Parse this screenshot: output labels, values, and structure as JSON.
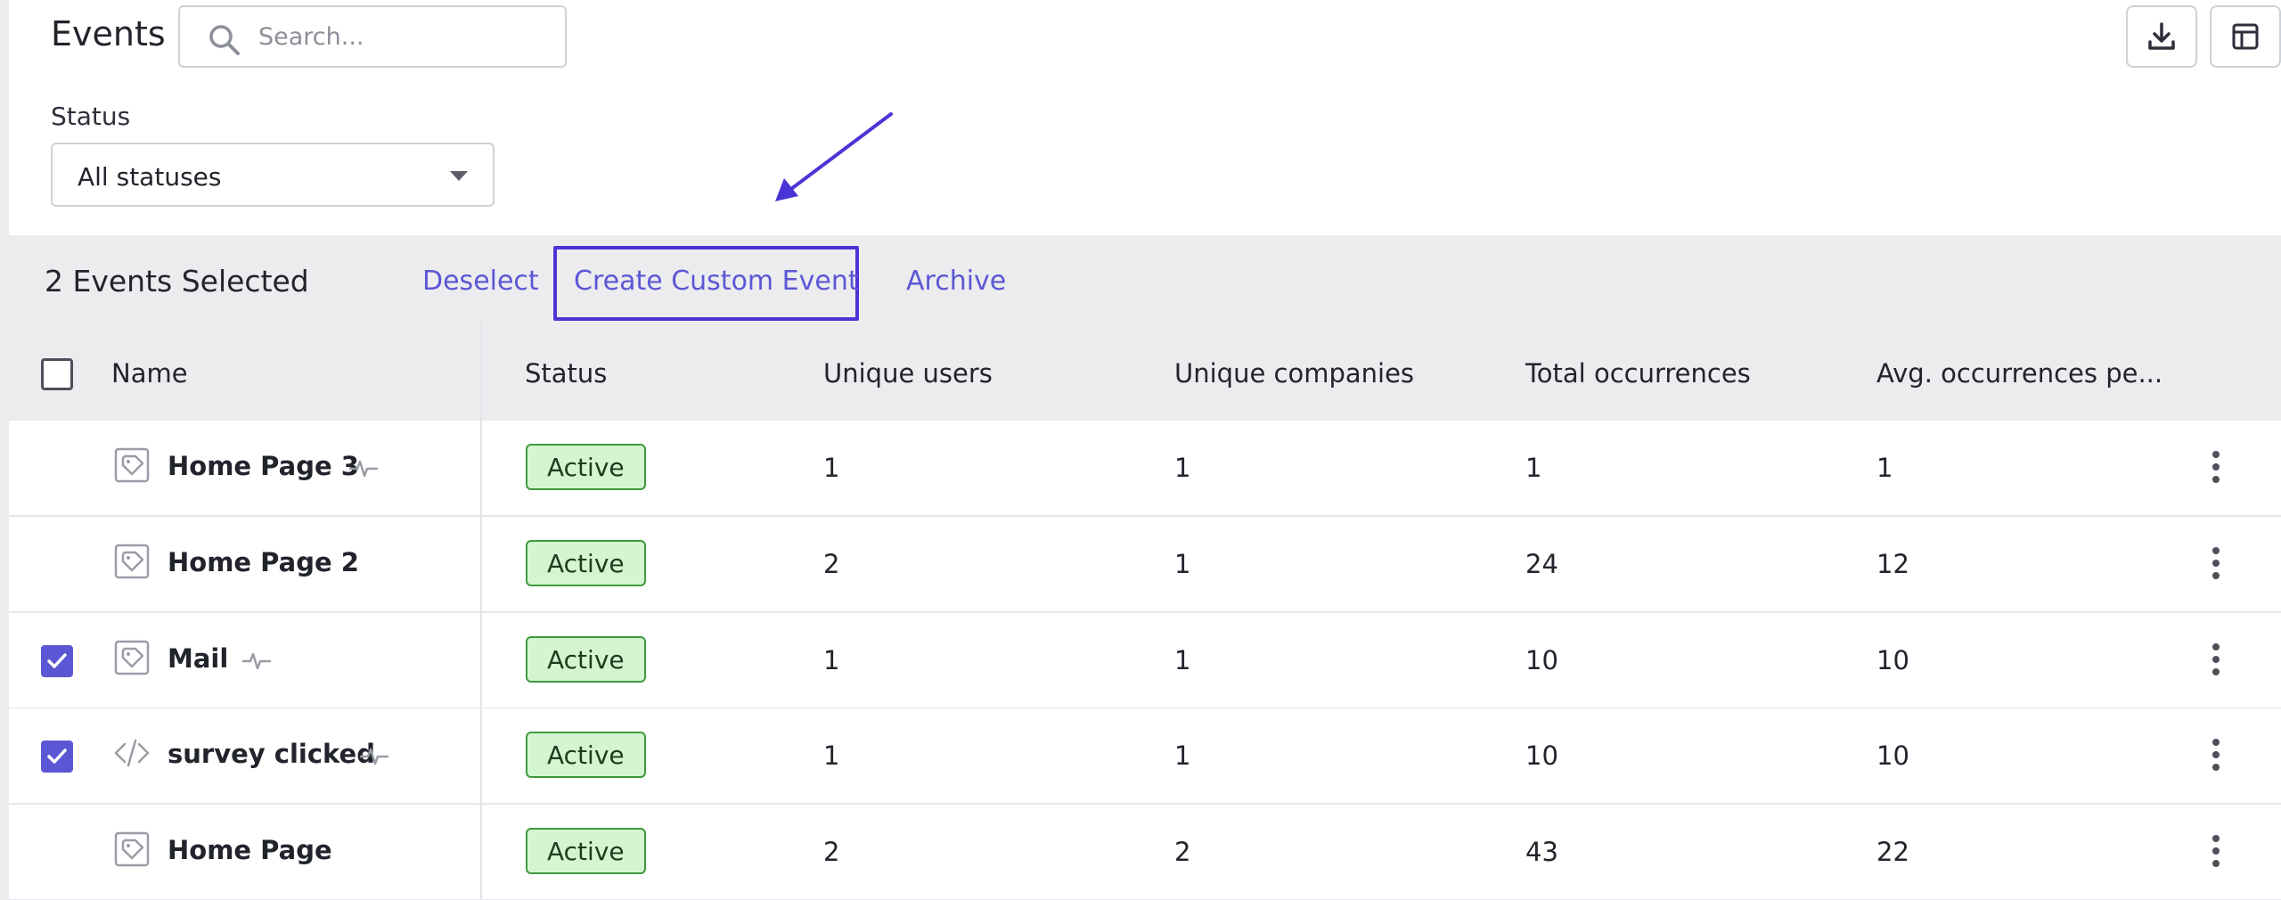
{
  "header": {
    "title": "Events",
    "search_placeholder": "Search...",
    "search_value": ""
  },
  "toolbar": {
    "download_icon": "download-icon",
    "columns_icon": "columns-icon"
  },
  "filter": {
    "status_label": "Status",
    "status_selected": "All statuses"
  },
  "bulk_actions": {
    "selected_count_text": "2 Events Selected",
    "deselect_label": "Deselect",
    "create_custom_event_label": "Create Custom Event",
    "archive_label": "Archive"
  },
  "table": {
    "columns": [
      "Name",
      "Status",
      "Unique users",
      "Unique companies",
      "Total occurrences",
      "Avg. occurrences pe..."
    ],
    "rows": [
      {
        "selected": false,
        "icon": "tag-icon",
        "name": "Home Page 3",
        "pulse": true,
        "status": "Active",
        "unique_users": "1",
        "unique_companies": "1",
        "total_occurrences": "1",
        "avg_occurrences": "1"
      },
      {
        "selected": false,
        "icon": "tag-icon",
        "name": "Home Page 2",
        "pulse": false,
        "status": "Active",
        "unique_users": "2",
        "unique_companies": "1",
        "total_occurrences": "24",
        "avg_occurrences": "12"
      },
      {
        "selected": true,
        "icon": "tag-icon",
        "name": "Mail",
        "pulse": true,
        "status": "Active",
        "unique_users": "1",
        "unique_companies": "1",
        "total_occurrences": "10",
        "avg_occurrences": "10"
      },
      {
        "selected": true,
        "icon": "code-icon",
        "name": "survey clicked",
        "pulse": true,
        "status": "Active",
        "unique_users": "1",
        "unique_companies": "1",
        "total_occurrences": "10",
        "avg_occurrences": "10"
      },
      {
        "selected": false,
        "icon": "tag-icon",
        "name": "Home Page",
        "pulse": false,
        "status": "Active",
        "unique_users": "2",
        "unique_companies": "2",
        "total_occurrences": "43",
        "avg_occurrences": "22"
      }
    ]
  },
  "colors": {
    "accent": "#5b57d4",
    "highlight": "#4a34d6",
    "badge_bg": "#d3f6d1",
    "badge_border": "#3e9a3c"
  }
}
